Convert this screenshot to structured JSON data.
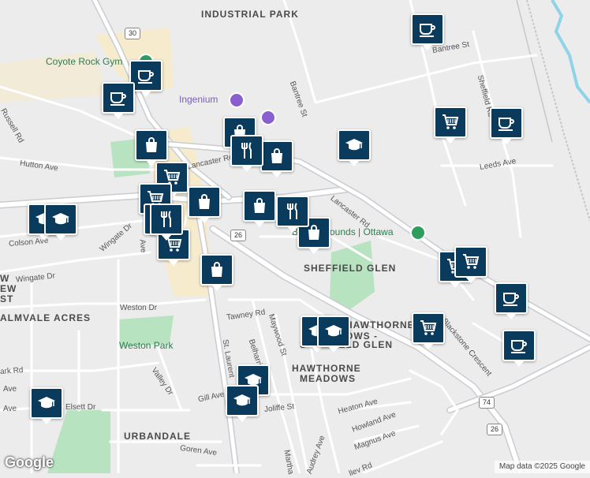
{
  "map": {
    "area_labels": [
      "INDUSTRIAL PARK",
      "SHEFFIELD GLEN",
      "HAWTHORNE",
      "OWS -",
      "S",
      "IELD GLEN",
      "HAWTHORNE",
      "MEADOWS",
      "URBANDALE",
      "ALMVALE ACRES",
      "W",
      "EW",
      "ST"
    ],
    "street_labels": [
      "Bantree St",
      "Bantree St",
      "Sheffield Rd",
      "Russell Rd",
      "Hutton Ave",
      "Lancaster Rd",
      "Lancaster Rd",
      "Leeds Ave",
      "Colson Ave",
      "Wingate Dr",
      "Wingate Dr",
      "Weston Dr",
      "Tawney Rd",
      "Maywood St",
      "Belharris Ave",
      "St. Laurent",
      "Valley Dr",
      "Gill Ave",
      "Elsett Dr",
      "Joliffe St",
      "Heaton Ave",
      "Howland Ave",
      "Magnus Ave",
      "Goren Ave",
      "Blackstone Crescent",
      "Audrey Ave",
      "Martha",
      "ark Rd",
      "Ave",
      "Ave",
      "llev Rd",
      "Ave"
    ],
    "poi_labels": [
      "Coyote Rock Gym",
      "Ingenium",
      "B",
      "rounds | Ottawa"
    ],
    "park_labels": [
      "Weston Park"
    ],
    "highway_shields": [
      "30",
      "26",
      "74",
      "26"
    ],
    "google_logo": "Google",
    "attribution": "Map data ©2025 Google"
  },
  "markers": [
    {
      "type": "cafe-icon"
    },
    {
      "type": "cafe-icon"
    },
    {
      "type": "cafe-icon"
    },
    {
      "type": "cafe-icon"
    },
    {
      "type": "cafe-icon"
    },
    {
      "type": "cafe-icon"
    },
    {
      "type": "shopping-cart-icon"
    },
    {
      "type": "shopping-cart-icon"
    },
    {
      "type": "shopping-cart-icon"
    },
    {
      "type": "shopping-cart-icon"
    },
    {
      "type": "shopping-cart-icon"
    },
    {
      "type": "shopping-cart-icon"
    },
    {
      "type": "shopping-cart-icon"
    },
    {
      "type": "shopping-cart-icon"
    },
    {
      "type": "shopping-bag-icon"
    },
    {
      "type": "shopping-bag-icon"
    },
    {
      "type": "shopping-bag-icon"
    },
    {
      "type": "shopping-bag-icon"
    },
    {
      "type": "shopping-bag-icon"
    },
    {
      "type": "shopping-bag-icon"
    },
    {
      "type": "shopping-bag-icon"
    },
    {
      "type": "restaurant-icon"
    },
    {
      "type": "restaurant-icon"
    },
    {
      "type": "restaurant-icon"
    },
    {
      "type": "school-icon"
    },
    {
      "type": "school-icon"
    },
    {
      "type": "school-icon"
    },
    {
      "type": "school-icon"
    },
    {
      "type": "school-icon"
    },
    {
      "type": "school-icon"
    },
    {
      "type": "school-icon"
    },
    {
      "type": "school-icon"
    }
  ],
  "colors": {
    "marker": "#0a3b5c",
    "road": "#ffffff",
    "major_road": "#c9ccd1",
    "park": "#b8e3c1",
    "commercial": "#f6ebcc",
    "water": "#8fd3e8",
    "background": "#ececec"
  }
}
